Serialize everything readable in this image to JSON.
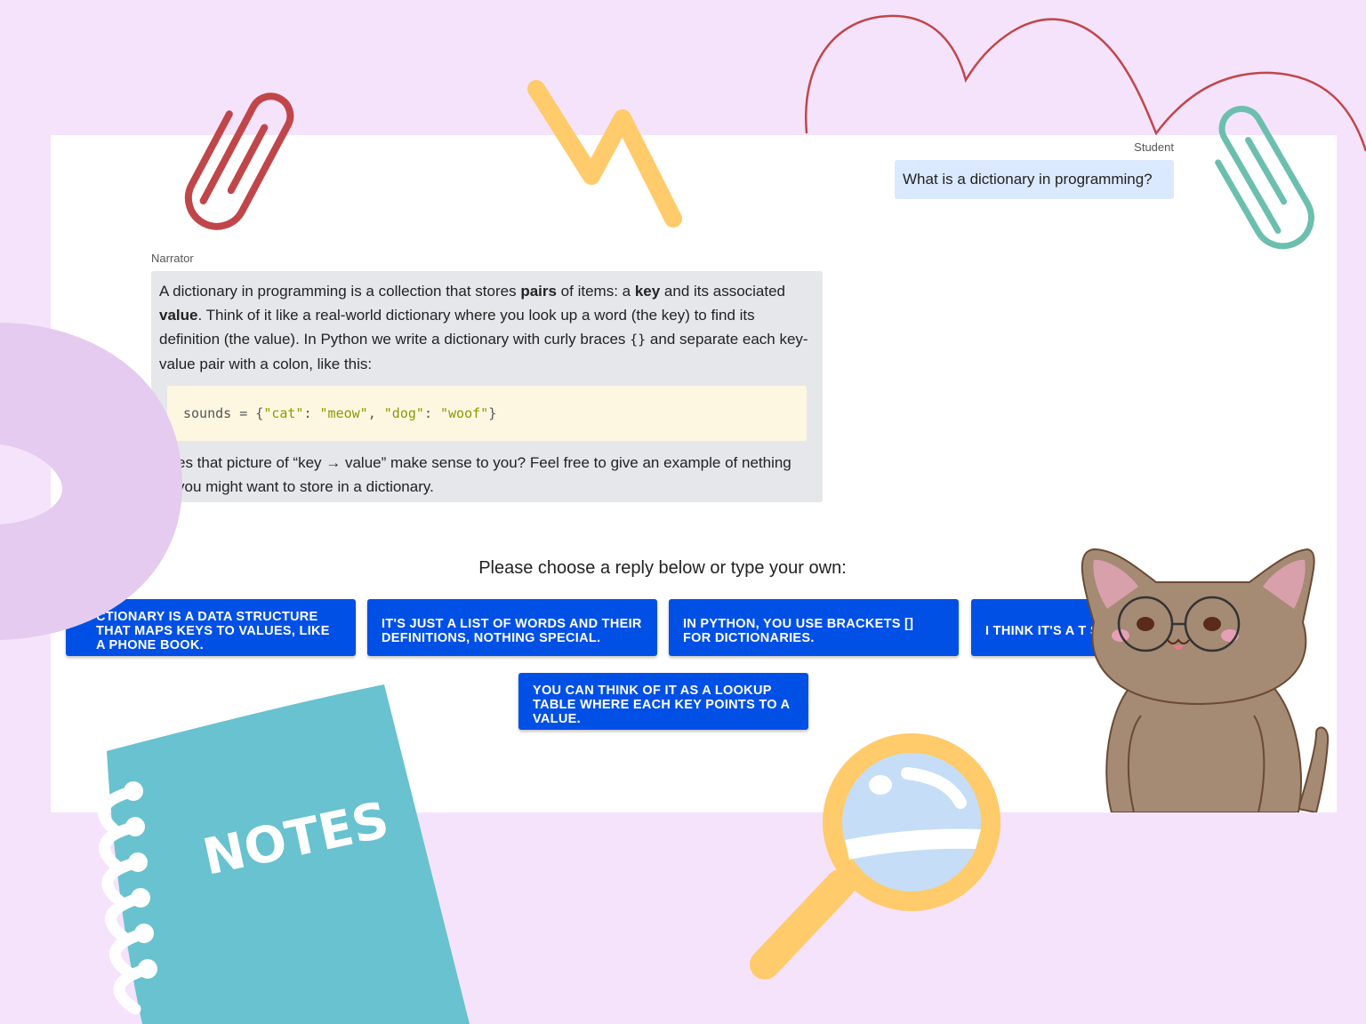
{
  "chat": {
    "student": {
      "label": "Student",
      "message": "What is a dictionary in programming?"
    },
    "narrator": {
      "label": "Narrator",
      "para1_a": "A dictionary in programming is a collection that stores ",
      "para1_b": "pairs",
      "para1_c": " of items: a ",
      "para1_d": "key",
      "para1_e": " and its associated ",
      "para1_f": "value",
      "para1_g": ". Think of it like a real-world dictionary where you look up a word (the key) to find its definition (the value). In Python we write a dictionary with curly braces ",
      "para1_h": "{}",
      "para1_i": " and separate each key-value pair with a colon, like this:",
      "code_prefix": "sounds = {",
      "code_s1": "\"cat\"",
      "code_sep1": ": ",
      "code_s2": "\"meow\"",
      "code_sep2": ", ",
      "code_s3": "\"dog\"",
      "code_sep3": ": ",
      "code_s4": "\"woof\"",
      "code_suffix": "}",
      "para2": "es that picture of “key → value” make sense to you? Feel free to give an example of nething you might want to store in a dictionary."
    }
  },
  "replies": {
    "prompt": "Please choose a reply below or type your own:",
    "options": [
      "CTIONARY IS A DATA STRUCTURE THAT MAPS KEYS TO VALUES, LIKE A PHONE BOOK.",
      "IT'S JUST A LIST OF WORDS AND THEIR DEFINITIONS, NOTHING SPECIAL.",
      "IN PYTHON, YOU USE BRACKETS [] FOR DICTIONARIES.",
      "I THINK IT'S A T STORES PAIRS",
      "YOU CAN THINK OF IT AS A LOOKUP TABLE WHERE EACH KEY POINTS TO A VALUE."
    ]
  },
  "decor": {
    "notes_text": "NOTES",
    "colors": {
      "background": "#f5e3fb",
      "button": "#0050e6",
      "student_bubble": "#dbe9ff",
      "narrator_bubble": "#e6e7eb",
      "code_bg": "#fdf7e1"
    }
  }
}
